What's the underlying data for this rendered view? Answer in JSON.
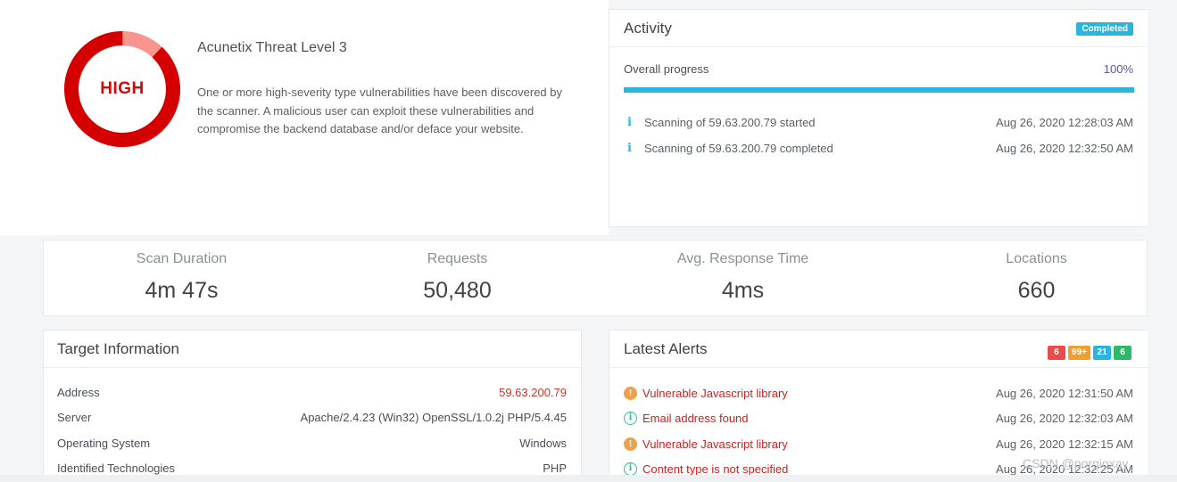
{
  "threat": {
    "level_label": "HIGH",
    "title": "Acunetix Threat Level 3",
    "description": "One or more high-severity type vulnerabilities have been discovered by the scanner. A malicious user can exploit these vulnerabilities and compromise the backend database and/or deface your website.",
    "ring_color": "#d40000",
    "ring_light_color": "#f7958e"
  },
  "activity": {
    "title": "Activity",
    "status_badge": "Completed",
    "progress_label": "Overall progress",
    "progress_value": "100%",
    "progress_fraction": 1.0,
    "events": [
      {
        "icon": "info-icon",
        "message": "Scanning of 59.63.200.79 started",
        "time": "Aug 26, 2020 12:28:03 AM"
      },
      {
        "icon": "info-icon",
        "message": "Scanning of 59.63.200.79 completed",
        "time": "Aug 26, 2020 12:32:50 AM"
      }
    ]
  },
  "stats": [
    {
      "label": "Scan Duration",
      "value": "4m 47s"
    },
    {
      "label": "Requests",
      "value": "50,480"
    },
    {
      "label": "Avg. Response Time",
      "value": "4ms"
    },
    {
      "label": "Locations",
      "value": "660"
    }
  ],
  "target": {
    "title": "Target Information",
    "rows": [
      {
        "key": "Address",
        "value": "59.63.200.79"
      },
      {
        "key": "Server",
        "value": "Apache/2.4.23 (Win32) OpenSSL/1.0.2j PHP/5.4.45"
      },
      {
        "key": "Operating System",
        "value": "Windows"
      },
      {
        "key": "Identified Technologies",
        "value": "PHP"
      }
    ]
  },
  "alerts": {
    "title": "Latest Alerts",
    "severity_counts": [
      {
        "label": "6",
        "color": "#e84d4d"
      },
      {
        "label": "99+",
        "color": "#f0a030"
      },
      {
        "label": "21",
        "color": "#29b5df"
      },
      {
        "label": "6",
        "color": "#2fb86a"
      }
    ],
    "items": [
      {
        "icon": "warning-icon",
        "message": "Vulnerable Javascript library",
        "time": "Aug 26, 2020 12:31:50 AM"
      },
      {
        "icon": "info-circle-icon",
        "message": "Email address found",
        "time": "Aug 26, 2020 12:32:03 AM"
      },
      {
        "icon": "warning-icon",
        "message": "Vulnerable Javascript library",
        "time": "Aug 26, 2020 12:32:15 AM"
      },
      {
        "icon": "info-circle-icon",
        "message": "Content type is not specified",
        "time": "Aug 26, 2020 12:32:25 AM"
      }
    ]
  },
  "watermark": "CSDN @porgioxay"
}
